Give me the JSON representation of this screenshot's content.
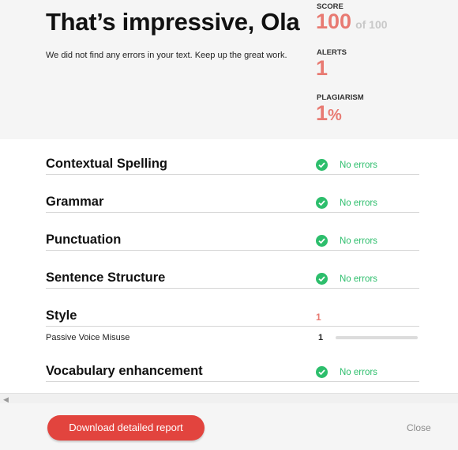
{
  "header": {
    "title": "That’s impressive, Ola",
    "subtitle": "We did not find any errors in your text. Keep up the great work."
  },
  "stats": {
    "score": {
      "label": "SCORE",
      "value": "100",
      "suffix": "of 100"
    },
    "alerts": {
      "label": "ALERTS",
      "value": "1"
    },
    "plagiarism": {
      "label": "PLAGIARISM",
      "value": "1",
      "unit": "%"
    }
  },
  "checks": [
    {
      "label": "Contextual Spelling",
      "status": "No errors"
    },
    {
      "label": "Grammar",
      "status": "No errors"
    },
    {
      "label": "Punctuation",
      "status": "No errors"
    },
    {
      "label": "Sentence Structure",
      "status": "No errors"
    },
    {
      "label": "Style",
      "count": "1"
    },
    {
      "label": "Vocabulary enhancement",
      "status": "No errors"
    }
  ],
  "style_detail": {
    "label": "Passive Voice Misuse",
    "count": "1",
    "bar_fraction": 0
  },
  "footer": {
    "download_label": "Download detailed report",
    "close_label": "Close"
  },
  "colors": {
    "accent_red": "#e87a72",
    "button_red": "#e2443e",
    "success_green": "#2dbe6c"
  }
}
